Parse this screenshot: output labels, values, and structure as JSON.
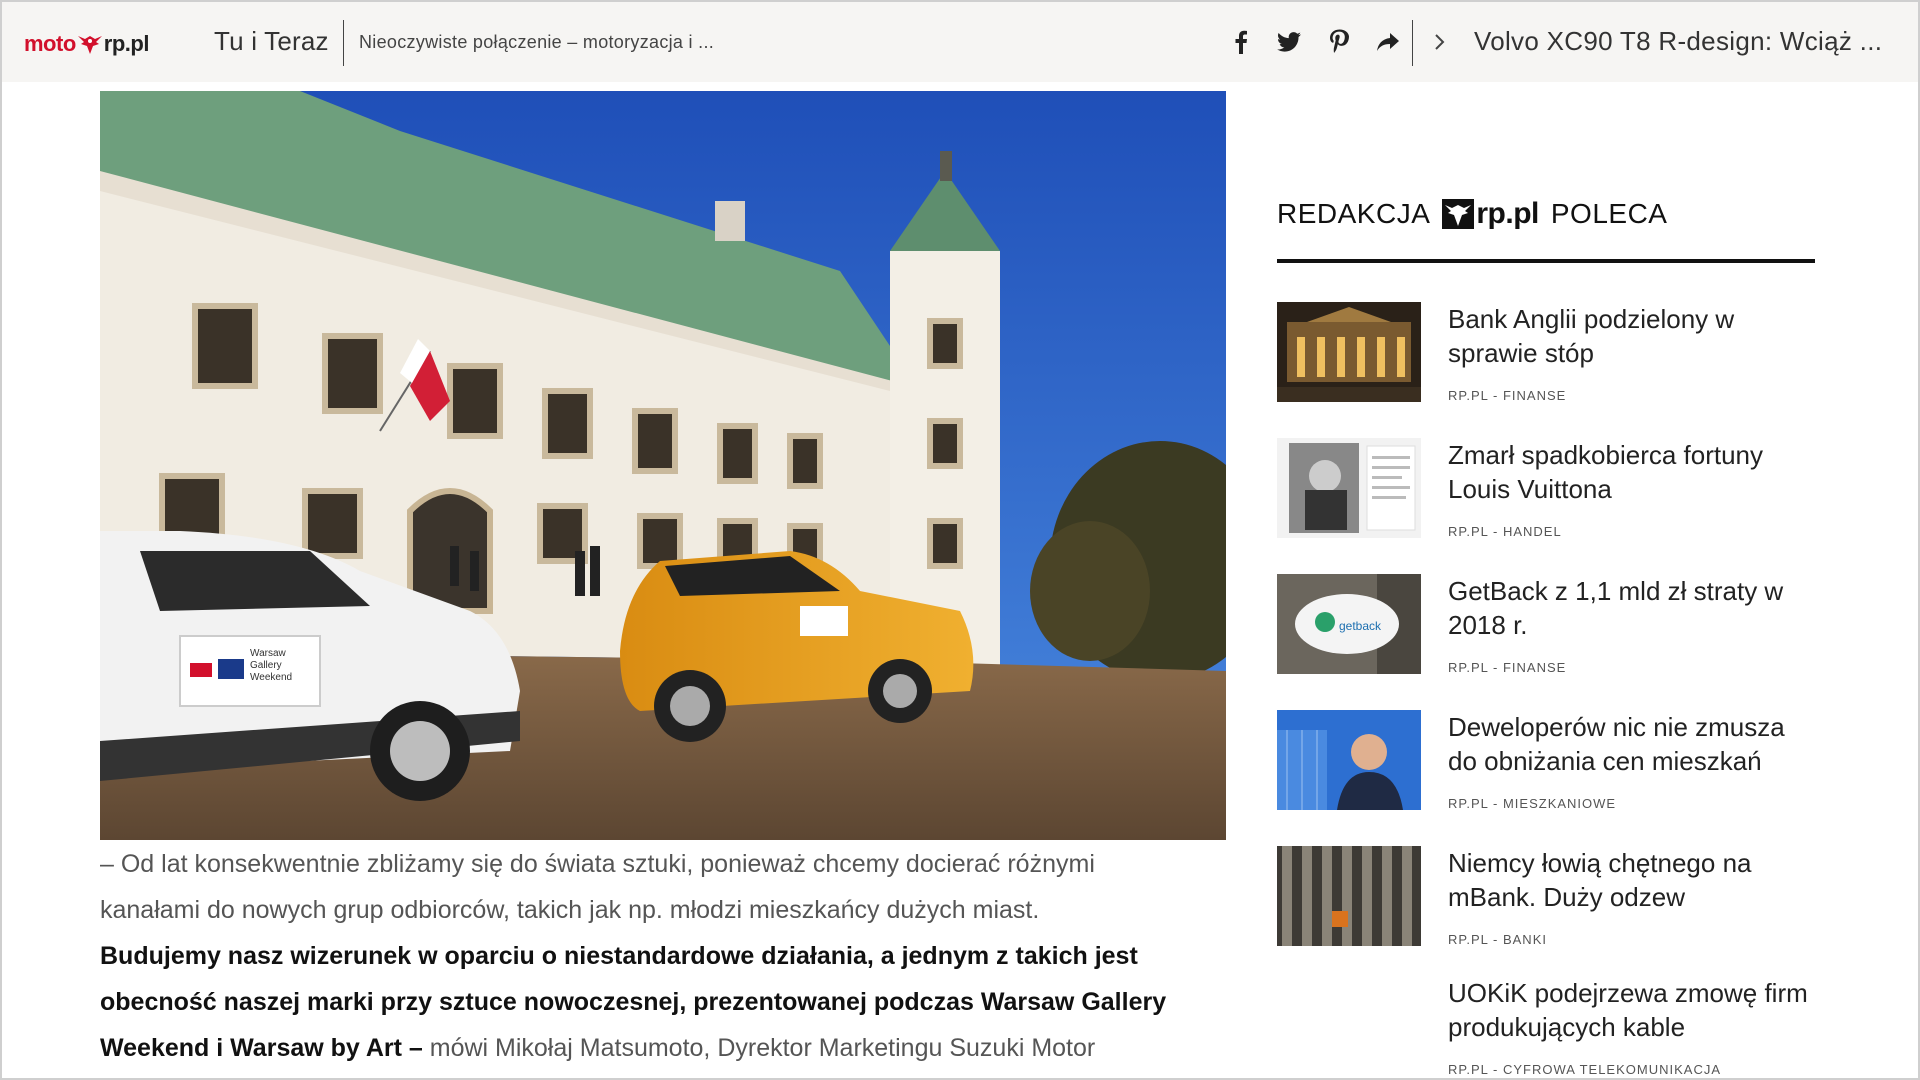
{
  "header": {
    "logo_moto": "moto",
    "logo_rp": "rp.pl",
    "section": "Tu i Teraz",
    "article_title": "Nieoczywiste połączenie – motoryzacja i ...",
    "social_icons": [
      "facebook-icon",
      "twitter-icon",
      "pinterest-icon",
      "share-icon"
    ],
    "next_article": "Volvo XC90 T8 R-design: Wciąż ..."
  },
  "photo": {
    "car_badge_line1": "Warsaw",
    "car_badge_line2": "Gallery",
    "car_badge_line3": "Weekend"
  },
  "article": {
    "line1": "– Od lat konsekwentnie zbliżamy się do świata sztuki, ponieważ chcemy docierać różnymi",
    "line2": "kanałami do nowych grup odbiorców, takich jak np. młodzi mieszkańcy dużych miast.",
    "bold1": "Budujemy nasz wizerunek w oparciu o niestandardowe działania, a jednym z takich jest",
    "bold2": "obecność naszej marki przy sztuce nowoczesnej, prezentowanej podczas Warsaw Gallery",
    "bold3": "Weekend i Warsaw by Art –",
    "line3_rest": " mówi Mikołaj Matsumoto, Dyrektor Marketingu Suzuki Motor"
  },
  "sidebar": {
    "header_left": "REDAKCJA",
    "header_brand": "rp.pl",
    "header_right": "POLECA",
    "items": [
      {
        "title": "Bank Anglii podzielony w sprawie stóp",
        "meta": "RP.PL - FINANSE"
      },
      {
        "title": "Zmarł spadkobierca fortuny Louis Vuittona",
        "meta": "RP.PL - HANDEL"
      },
      {
        "title": "GetBack z 1,1 mld zł straty w 2018 r.",
        "meta": "RP.PL - FINANSE",
        "thumb_text": "getback"
      },
      {
        "title": "Deweloperów nic nie zmusza do obniżania cen mieszkań",
        "meta": "RP.PL - MIESZKANIOWE"
      },
      {
        "title": "Niemcy łowią chętnego na mBank. Duży odzew",
        "meta": "RP.PL - BANKI"
      },
      {
        "title": "UOKiK podejrzewa zmowę firm produkujących kable",
        "meta": "RP.PL - CYFROWA TELEKOMUNIKACJA"
      }
    ]
  },
  "colors": {
    "brand_red": "#d2102c",
    "topbar_bg": "#f6f5f3",
    "text_dark": "#111111",
    "text_muted": "#555555"
  }
}
